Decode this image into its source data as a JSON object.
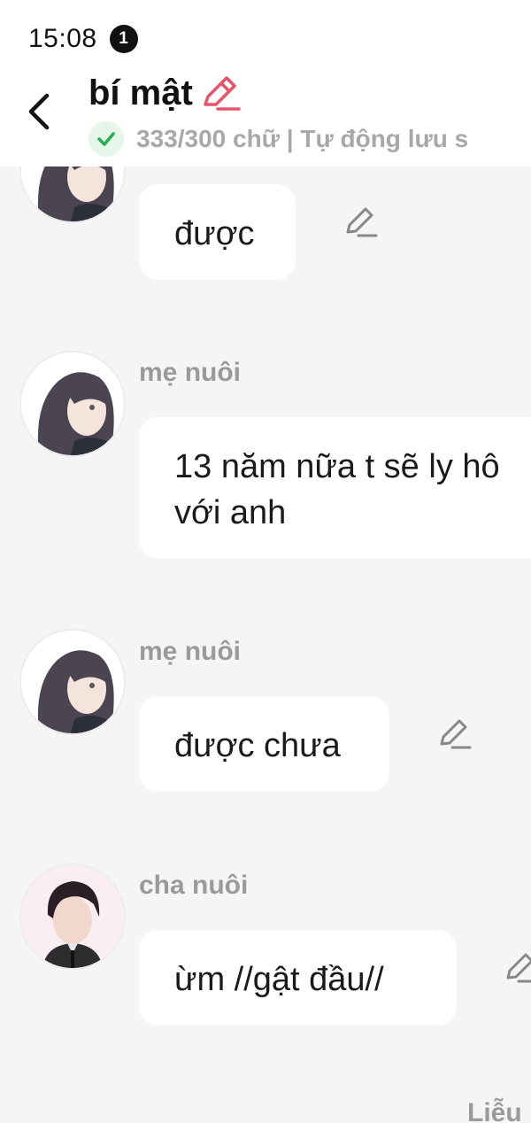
{
  "status_bar": {
    "time": "15:08",
    "notification_count": "1"
  },
  "header": {
    "title": "bí mật",
    "subtitle": "333/300 chữ | Tự động lưu s",
    "accent_color": "#e8536a",
    "save_ok_color": "#22b14c"
  },
  "messages": [
    {
      "sender": "",
      "avatar": "female-avatar",
      "text": "được",
      "editable": true
    },
    {
      "sender": "mẹ nuôi",
      "avatar": "female-avatar",
      "text": "13 năm nữa t sẽ ly hô\nvới anh",
      "editable": false
    },
    {
      "sender": "mẹ nuôi",
      "avatar": "female-avatar",
      "text": "được chưa",
      "editable": true
    },
    {
      "sender": "cha nuôi",
      "avatar": "male-avatar",
      "text": "ừm //gật đầu//",
      "editable": true
    }
  ],
  "next_sender_partial": "Liễu"
}
